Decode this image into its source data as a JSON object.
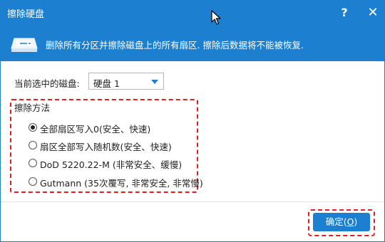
{
  "window": {
    "title": "擦除硬盘",
    "help_label": "?",
    "close_label": "✕"
  },
  "banner": {
    "icon": "disk-eraser-icon",
    "message": "删除所有分区并擦除磁盘上的所有扇区. 擦除后数据将不能被恢复."
  },
  "disk": {
    "label": "当前选中的磁盘:",
    "selected": "硬盘  1"
  },
  "method": {
    "title": "擦除方法",
    "options": [
      {
        "label": "全部扇区写入0(安全、快速)",
        "checked": true
      },
      {
        "label": "扇区全部写入随机数(安全、快速)",
        "checked": false
      },
      {
        "label": "DoD 5220.22-M (非常安全、缓慢)",
        "checked": false
      },
      {
        "label": "Gutmann (35次覆写, 非常安全, 非常慢)",
        "checked": false
      }
    ]
  },
  "footer": {
    "ok_label": "确定(",
    "ok_hotkey": "O",
    "ok_suffix": ")"
  },
  "colors": {
    "accent": "#1d7fcf",
    "highlight": "#e02020"
  }
}
